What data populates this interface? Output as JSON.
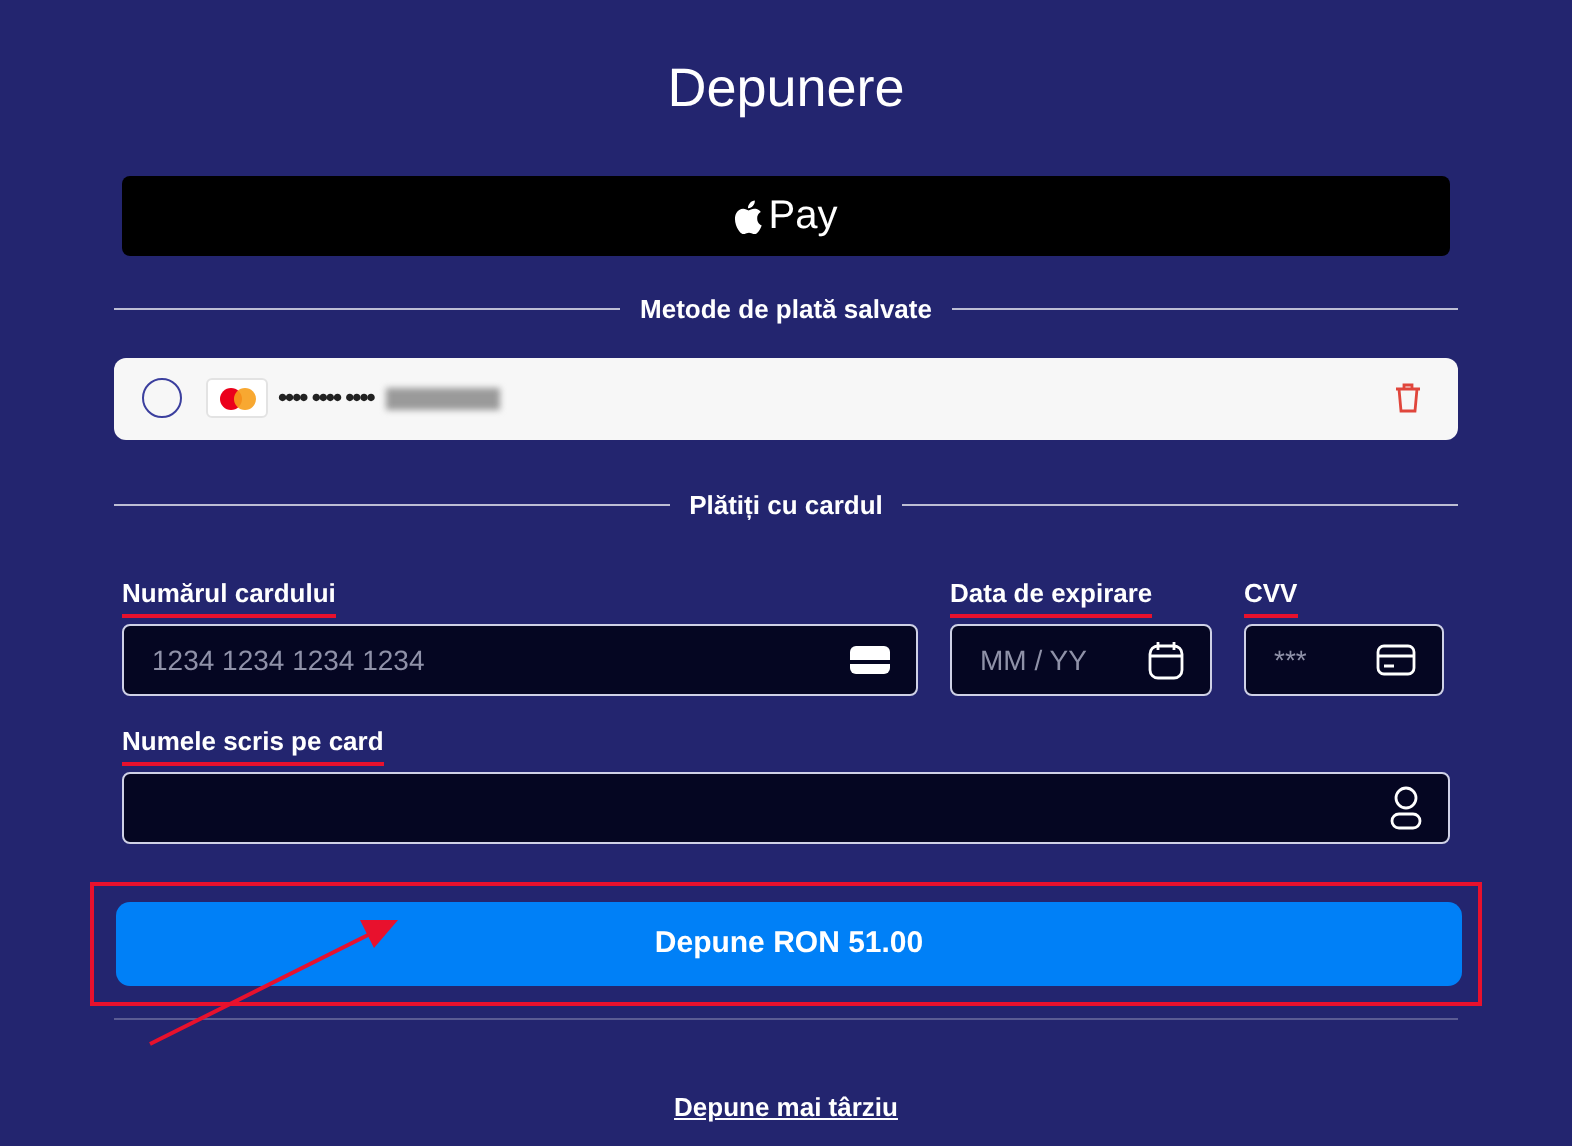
{
  "title": "Depunere",
  "apple_pay": {
    "label": "Pay"
  },
  "saved_methods": {
    "heading": "Metode de plată salvate",
    "cards": [
      {
        "selected": false,
        "masked_number": "•••• •••• ••••",
        "redacted": true
      }
    ]
  },
  "card_section": {
    "heading": "Plătiți cu cardul"
  },
  "fields": [
    {
      "kind": "card",
      "label": "Numărul cardului",
      "placeholder": "1234 1234 1234 1234",
      "highlighted": true
    },
    {
      "kind": "expiry",
      "label": "Data de expirare",
      "placeholder": "MM / YY",
      "highlighted": true
    },
    {
      "kind": "cvv",
      "label": "CVV",
      "placeholder": "***",
      "highlighted": true
    },
    {
      "kind": "name",
      "label": "Numele scris pe card",
      "highlighted": true
    }
  ],
  "submit": {
    "label": "Depune RON 51.00",
    "highlighted": true
  },
  "annotation_arrow": true,
  "later_link": "Depune mai târziu"
}
